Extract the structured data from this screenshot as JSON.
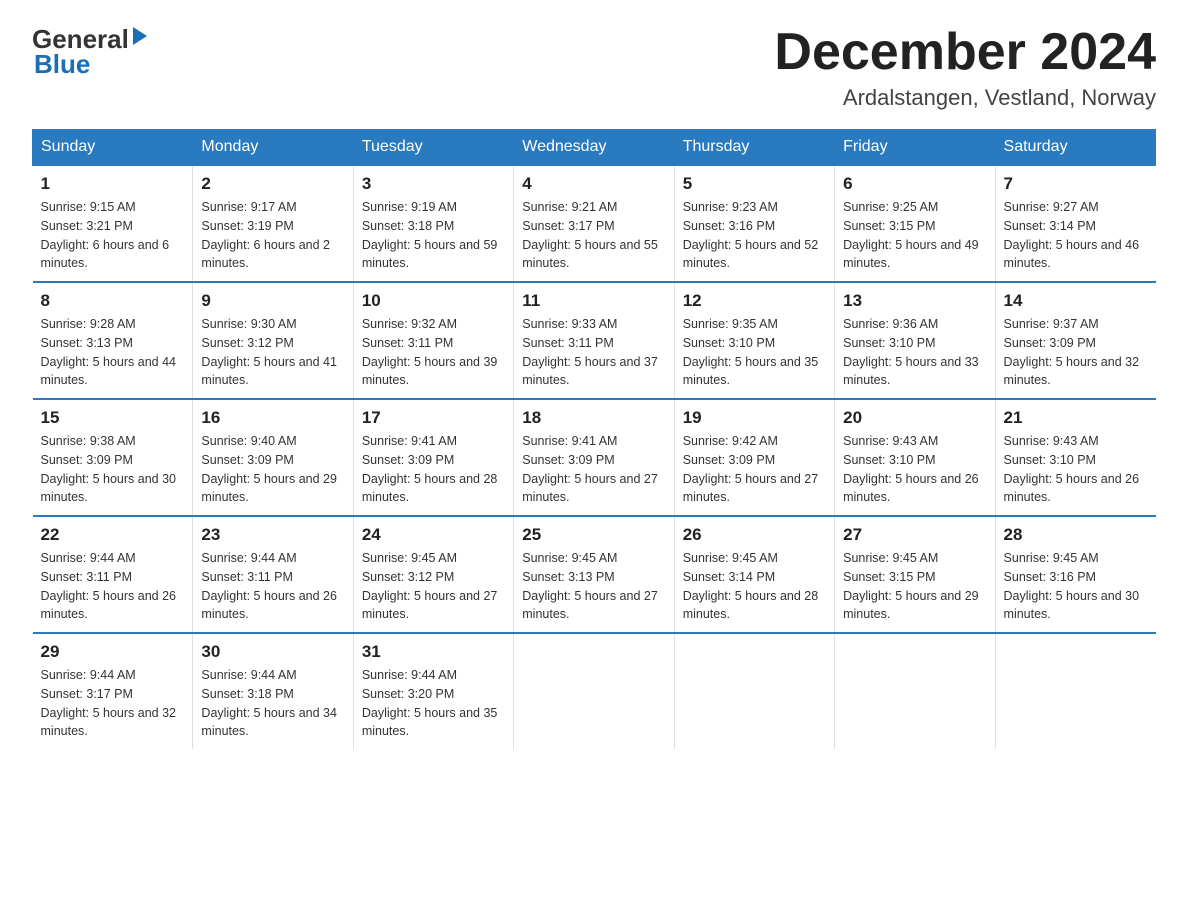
{
  "header": {
    "month_title": "December 2024",
    "location": "Ardalstangen, Vestland, Norway",
    "logo_general": "General",
    "logo_blue": "Blue"
  },
  "days_of_week": [
    "Sunday",
    "Monday",
    "Tuesday",
    "Wednesday",
    "Thursday",
    "Friday",
    "Saturday"
  ],
  "weeks": [
    [
      {
        "day": "1",
        "sunrise": "Sunrise: 9:15 AM",
        "sunset": "Sunset: 3:21 PM",
        "daylight": "Daylight: 6 hours and 6 minutes."
      },
      {
        "day": "2",
        "sunrise": "Sunrise: 9:17 AM",
        "sunset": "Sunset: 3:19 PM",
        "daylight": "Daylight: 6 hours and 2 minutes."
      },
      {
        "day": "3",
        "sunrise": "Sunrise: 9:19 AM",
        "sunset": "Sunset: 3:18 PM",
        "daylight": "Daylight: 5 hours and 59 minutes."
      },
      {
        "day": "4",
        "sunrise": "Sunrise: 9:21 AM",
        "sunset": "Sunset: 3:17 PM",
        "daylight": "Daylight: 5 hours and 55 minutes."
      },
      {
        "day": "5",
        "sunrise": "Sunrise: 9:23 AM",
        "sunset": "Sunset: 3:16 PM",
        "daylight": "Daylight: 5 hours and 52 minutes."
      },
      {
        "day": "6",
        "sunrise": "Sunrise: 9:25 AM",
        "sunset": "Sunset: 3:15 PM",
        "daylight": "Daylight: 5 hours and 49 minutes."
      },
      {
        "day": "7",
        "sunrise": "Sunrise: 9:27 AM",
        "sunset": "Sunset: 3:14 PM",
        "daylight": "Daylight: 5 hours and 46 minutes."
      }
    ],
    [
      {
        "day": "8",
        "sunrise": "Sunrise: 9:28 AM",
        "sunset": "Sunset: 3:13 PM",
        "daylight": "Daylight: 5 hours and 44 minutes."
      },
      {
        "day": "9",
        "sunrise": "Sunrise: 9:30 AM",
        "sunset": "Sunset: 3:12 PM",
        "daylight": "Daylight: 5 hours and 41 minutes."
      },
      {
        "day": "10",
        "sunrise": "Sunrise: 9:32 AM",
        "sunset": "Sunset: 3:11 PM",
        "daylight": "Daylight: 5 hours and 39 minutes."
      },
      {
        "day": "11",
        "sunrise": "Sunrise: 9:33 AM",
        "sunset": "Sunset: 3:11 PM",
        "daylight": "Daylight: 5 hours and 37 minutes."
      },
      {
        "day": "12",
        "sunrise": "Sunrise: 9:35 AM",
        "sunset": "Sunset: 3:10 PM",
        "daylight": "Daylight: 5 hours and 35 minutes."
      },
      {
        "day": "13",
        "sunrise": "Sunrise: 9:36 AM",
        "sunset": "Sunset: 3:10 PM",
        "daylight": "Daylight: 5 hours and 33 minutes."
      },
      {
        "day": "14",
        "sunrise": "Sunrise: 9:37 AM",
        "sunset": "Sunset: 3:09 PM",
        "daylight": "Daylight: 5 hours and 32 minutes."
      }
    ],
    [
      {
        "day": "15",
        "sunrise": "Sunrise: 9:38 AM",
        "sunset": "Sunset: 3:09 PM",
        "daylight": "Daylight: 5 hours and 30 minutes."
      },
      {
        "day": "16",
        "sunrise": "Sunrise: 9:40 AM",
        "sunset": "Sunset: 3:09 PM",
        "daylight": "Daylight: 5 hours and 29 minutes."
      },
      {
        "day": "17",
        "sunrise": "Sunrise: 9:41 AM",
        "sunset": "Sunset: 3:09 PM",
        "daylight": "Daylight: 5 hours and 28 minutes."
      },
      {
        "day": "18",
        "sunrise": "Sunrise: 9:41 AM",
        "sunset": "Sunset: 3:09 PM",
        "daylight": "Daylight: 5 hours and 27 minutes."
      },
      {
        "day": "19",
        "sunrise": "Sunrise: 9:42 AM",
        "sunset": "Sunset: 3:09 PM",
        "daylight": "Daylight: 5 hours and 27 minutes."
      },
      {
        "day": "20",
        "sunrise": "Sunrise: 9:43 AM",
        "sunset": "Sunset: 3:10 PM",
        "daylight": "Daylight: 5 hours and 26 minutes."
      },
      {
        "day": "21",
        "sunrise": "Sunrise: 9:43 AM",
        "sunset": "Sunset: 3:10 PM",
        "daylight": "Daylight: 5 hours and 26 minutes."
      }
    ],
    [
      {
        "day": "22",
        "sunrise": "Sunrise: 9:44 AM",
        "sunset": "Sunset: 3:11 PM",
        "daylight": "Daylight: 5 hours and 26 minutes."
      },
      {
        "day": "23",
        "sunrise": "Sunrise: 9:44 AM",
        "sunset": "Sunset: 3:11 PM",
        "daylight": "Daylight: 5 hours and 26 minutes."
      },
      {
        "day": "24",
        "sunrise": "Sunrise: 9:45 AM",
        "sunset": "Sunset: 3:12 PM",
        "daylight": "Daylight: 5 hours and 27 minutes."
      },
      {
        "day": "25",
        "sunrise": "Sunrise: 9:45 AM",
        "sunset": "Sunset: 3:13 PM",
        "daylight": "Daylight: 5 hours and 27 minutes."
      },
      {
        "day": "26",
        "sunrise": "Sunrise: 9:45 AM",
        "sunset": "Sunset: 3:14 PM",
        "daylight": "Daylight: 5 hours and 28 minutes."
      },
      {
        "day": "27",
        "sunrise": "Sunrise: 9:45 AM",
        "sunset": "Sunset: 3:15 PM",
        "daylight": "Daylight: 5 hours and 29 minutes."
      },
      {
        "day": "28",
        "sunrise": "Sunrise: 9:45 AM",
        "sunset": "Sunset: 3:16 PM",
        "daylight": "Daylight: 5 hours and 30 minutes."
      }
    ],
    [
      {
        "day": "29",
        "sunrise": "Sunrise: 9:44 AM",
        "sunset": "Sunset: 3:17 PM",
        "daylight": "Daylight: 5 hours and 32 minutes."
      },
      {
        "day": "30",
        "sunrise": "Sunrise: 9:44 AM",
        "sunset": "Sunset: 3:18 PM",
        "daylight": "Daylight: 5 hours and 34 minutes."
      },
      {
        "day": "31",
        "sunrise": "Sunrise: 9:44 AM",
        "sunset": "Sunset: 3:20 PM",
        "daylight": "Daylight: 5 hours and 35 minutes."
      },
      null,
      null,
      null,
      null
    ]
  ]
}
